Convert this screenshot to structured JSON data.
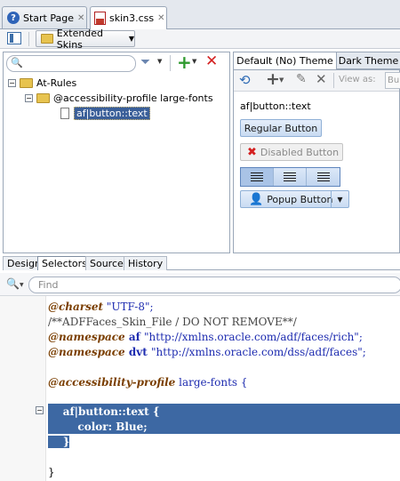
{
  "tabs": [
    {
      "label": "Start Page"
    },
    {
      "label": "skin3.css"
    }
  ],
  "toolbar": {
    "skins_label": "Extended Skins"
  },
  "selectors_tree": {
    "root": "At-Rules",
    "child": "@accessibility-profile large-fonts",
    "leaf": "af|button::text"
  },
  "preview": {
    "tabs": [
      "Default (No) Theme",
      "Dark Theme"
    ],
    "view_as_label": "View as:",
    "view_as_value": "Bu",
    "selector_label": "af|button::text",
    "regular_button": "Regular Button",
    "disabled_button": "Disabled Button",
    "popup_button": "Popup Button"
  },
  "bottom_tabs": [
    "Design",
    "Selectors",
    "Source",
    "History"
  ],
  "find": {
    "placeholder": "Find"
  },
  "code": {
    "l1a": "@charset",
    "l1b": " \"UTF-8\";",
    "l2": "/**ADFFaces_Skin_File / DO NOT REMOVE**/",
    "l3a": "@namespace",
    "l3b": " af ",
    "l3c": "\"http://xmlns.oracle.com/adf/faces/rich\";",
    "l4a": "@namespace",
    "l4b": " dvt ",
    "l4c": "\"http://xmlns.oracle.com/dss/adf/faces\";",
    "l5a": "@accessibility-profile",
    "l5b": " large-fonts {",
    "l6": "    af|button::text {",
    "l7": "        color: Blue;",
    "l8": "    }",
    "l9": "}"
  }
}
